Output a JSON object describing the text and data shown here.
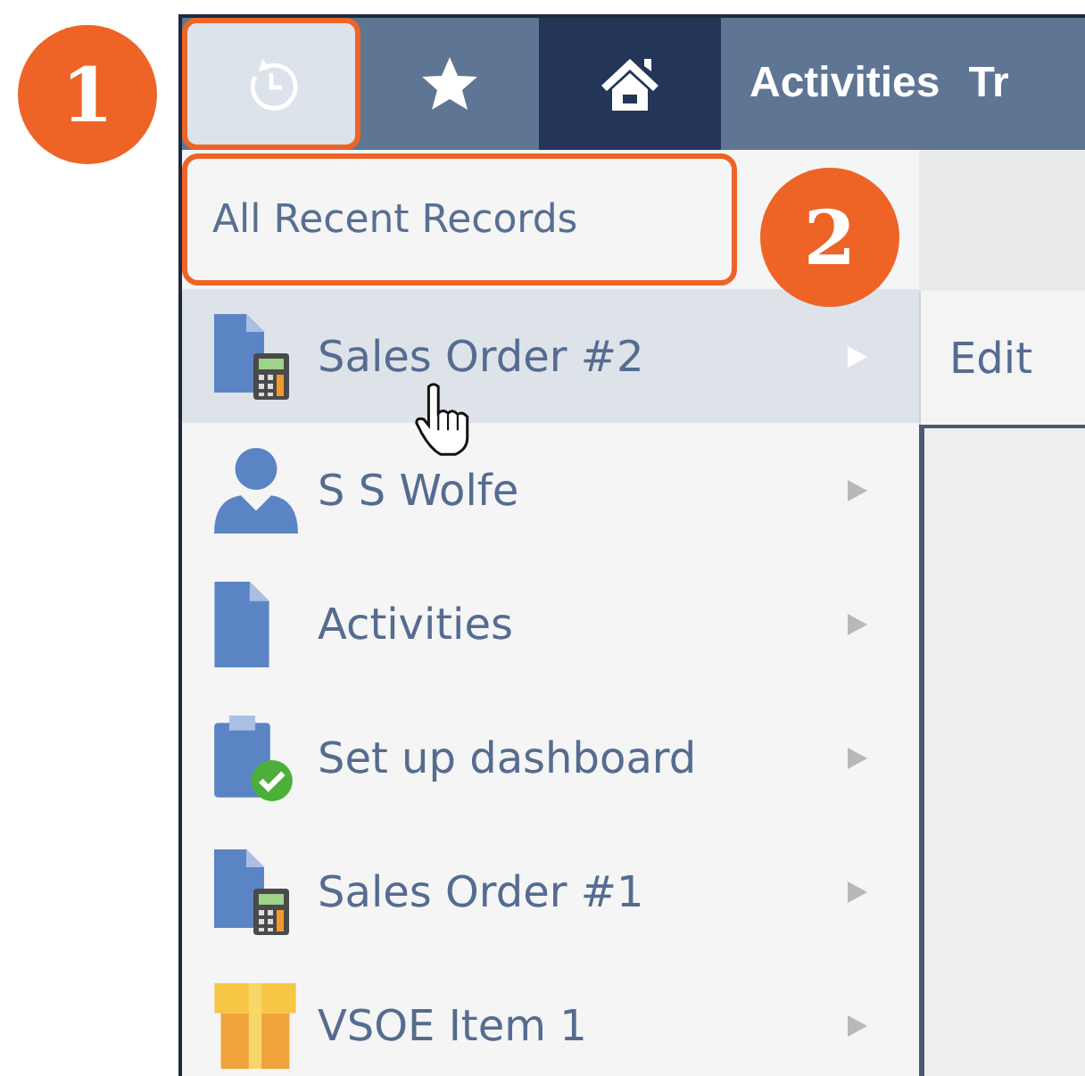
{
  "callouts": [
    {
      "label": "1"
    },
    {
      "label": "2"
    }
  ],
  "nav": {
    "buttons": [
      {
        "kind": "recent",
        "selected": false,
        "expanded": true
      },
      {
        "kind": "star",
        "selected": false,
        "expanded": false
      },
      {
        "kind": "home",
        "selected": true,
        "expanded": false
      }
    ],
    "links": [
      "Activities",
      "Tr"
    ]
  },
  "recent_menu": {
    "header": "All Recent Records",
    "items": [
      {
        "label": "Sales Order #2",
        "kind": "order",
        "selected": true
      },
      {
        "label": "S S Wolfe",
        "kind": "person",
        "selected": false
      },
      {
        "label": "Activities",
        "kind": "document",
        "selected": false
      },
      {
        "label": "Set up dashboard",
        "kind": "task",
        "selected": false
      },
      {
        "label": "Sales Order #1",
        "kind": "order",
        "selected": false
      },
      {
        "label": "VSOE Item 1",
        "kind": "item",
        "selected": false
      }
    ]
  },
  "submenu": {
    "items": [
      "Edit"
    ]
  }
}
